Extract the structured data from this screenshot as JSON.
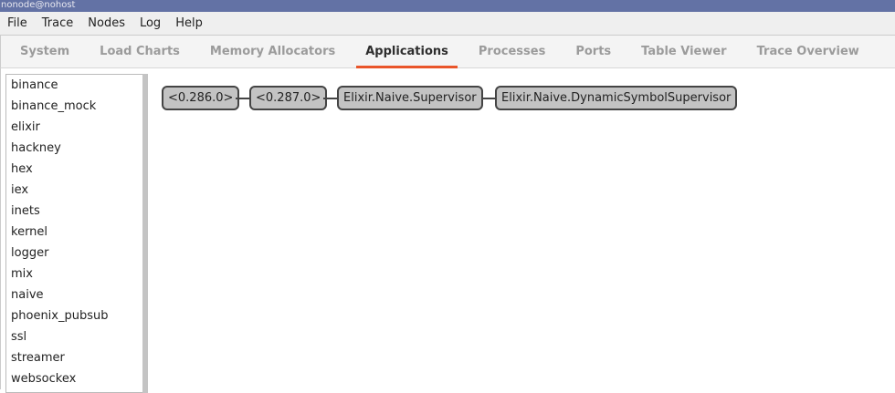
{
  "window": {
    "title": "nonode@nohost"
  },
  "menu": [
    "File",
    "Trace",
    "Nodes",
    "Log",
    "Help"
  ],
  "tabs": [
    {
      "label": "System"
    },
    {
      "label": "Load Charts"
    },
    {
      "label": "Memory Allocators"
    },
    {
      "label": "Applications",
      "active": true
    },
    {
      "label": "Processes"
    },
    {
      "label": "Ports"
    },
    {
      "label": "Table Viewer"
    },
    {
      "label": "Trace Overview"
    }
  ],
  "applications": [
    "binance",
    "binance_mock",
    "elixir",
    "hackney",
    "hex",
    "iex",
    "inets",
    "kernel",
    "logger",
    "mix",
    "naive",
    "phoenix_pubsub",
    "ssl",
    "streamer",
    "websockex"
  ],
  "tree": {
    "nodes": [
      "<0.286.0>",
      "<0.287.0>",
      "Elixir.Naive.Supervisor",
      "Elixir.Naive.DynamicSymbolSupervisor"
    ]
  },
  "colors": {
    "accent": "#e9552a",
    "titlebar": "#6372a5",
    "node_fill": "#c3c3c3"
  }
}
